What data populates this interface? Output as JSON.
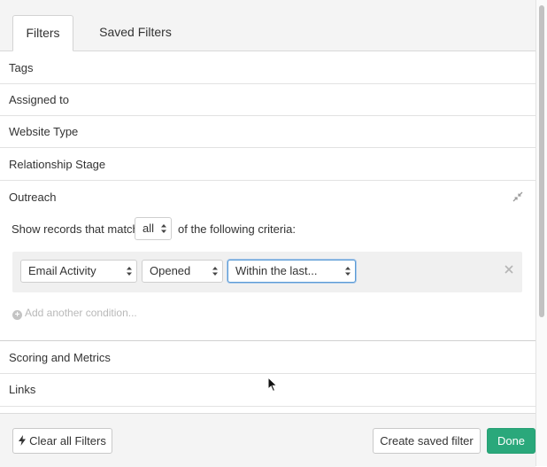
{
  "tabs": [
    {
      "label": "Filters",
      "active": true
    },
    {
      "label": "Saved Filters",
      "active": false
    }
  ],
  "sections": {
    "tags": "Tags",
    "assigned_to": "Assigned to",
    "website_type": "Website Type",
    "relationship_stage": "Relationship Stage",
    "outreach": "Outreach",
    "scoring_metrics": "Scoring and Metrics",
    "links": "Links"
  },
  "outreach": {
    "match_prefix": "Show records that match",
    "match_value": "all",
    "match_suffix": "of the following criteria:",
    "condition": {
      "field": "Email Activity",
      "operator": "Opened",
      "range": "Within the last..."
    },
    "add_condition": "Add another condition..."
  },
  "footer": {
    "clear_label": "Clear all Filters",
    "create_saved_label": "Create saved filter",
    "done_label": "Done"
  },
  "colors": {
    "accent": "#2aa87b",
    "focus": "#5b9bd5"
  }
}
